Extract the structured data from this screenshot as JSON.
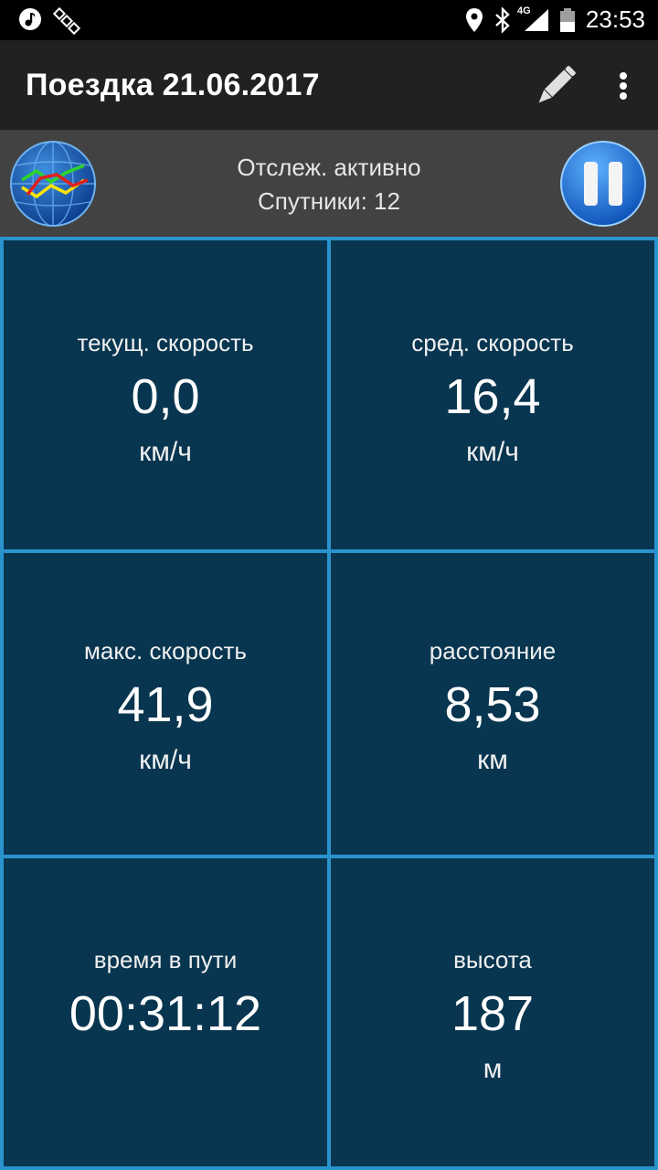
{
  "status_bar": {
    "time": "23:53",
    "network": "4G",
    "icons": [
      "music-note-icon",
      "satellite-icon",
      "location-pin-icon",
      "bluetooth-icon",
      "signal-icon",
      "battery-icon"
    ]
  },
  "app_bar": {
    "title": "Поездка 21.06.2017",
    "icons": [
      "pencil-icon",
      "more-vert-icon"
    ]
  },
  "tracking": {
    "status": "Отслеж. активно",
    "satellites": "Спутники: 12",
    "icons": [
      "graph-globe-icon",
      "pause-icon"
    ]
  },
  "stats": [
    {
      "label": "текущ. скорость",
      "value": "0,0",
      "unit": "км/ч"
    },
    {
      "label": "сред. скорость",
      "value": "16,4",
      "unit": "км/ч"
    },
    {
      "label": "макс. скорость",
      "value": "41,9",
      "unit": "км/ч"
    },
    {
      "label": "расстояние",
      "value": "8,53",
      "unit": "км"
    },
    {
      "label": "время в пути",
      "value": "00:31:12",
      "unit": ""
    },
    {
      "label": "высота",
      "value": "187",
      "unit": "м"
    }
  ],
  "colors": {
    "status_bar_bg": "#000000",
    "app_bar_bg": "#212121",
    "track_bar_bg": "#424242",
    "cell_bg": "#083650",
    "grid_border": "#2a93cd"
  }
}
